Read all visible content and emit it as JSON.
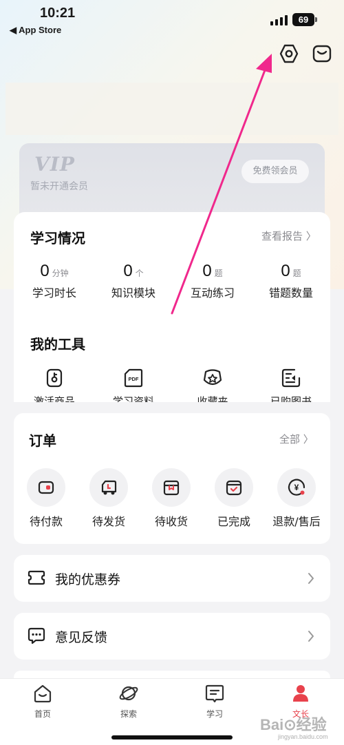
{
  "status_bar": {
    "time": "10:21",
    "back_label": "◀ App Store",
    "battery": "69"
  },
  "header": {
    "settings_icon": "settings-icon",
    "message_icon": "message-icon"
  },
  "vip": {
    "logo": "VIP",
    "status": "暂未开通会员",
    "cta": "免费领会员"
  },
  "study": {
    "title": "学习情况",
    "report_link": "查看报告 〉",
    "stats": [
      {
        "value": "0",
        "unit": "分钟",
        "label": "学习时长"
      },
      {
        "value": "0",
        "unit": "个",
        "label": "知识模块"
      },
      {
        "value": "0",
        "unit": "题",
        "label": "互动练习"
      },
      {
        "value": "0",
        "unit": "题",
        "label": "错题数量"
      }
    ]
  },
  "tools": {
    "title": "我的工具",
    "items": [
      {
        "label": "激活商品",
        "icon": "key-icon"
      },
      {
        "label": "学习资料",
        "icon": "pdf-icon"
      },
      {
        "label": "收藏夹",
        "icon": "star-icon"
      },
      {
        "label": "已购图书",
        "icon": "book-icon"
      }
    ]
  },
  "orders": {
    "title": "订单",
    "all_link": "全部 〉",
    "items": [
      {
        "label": "待付款",
        "icon": "wallet-icon"
      },
      {
        "label": "待发货",
        "icon": "truck-icon"
      },
      {
        "label": "待收货",
        "icon": "box-icon"
      },
      {
        "label": "已完成",
        "icon": "completed-icon"
      },
      {
        "label": "退款/售后",
        "icon": "refund-icon"
      }
    ]
  },
  "coupons": {
    "label": "我的优惠券",
    "icon": "coupon-icon"
  },
  "feedback": {
    "label": "意见反馈",
    "icon": "feedback-icon"
  },
  "tabbar": {
    "items": [
      {
        "label": "首页",
        "icon": "home-icon",
        "active": false
      },
      {
        "label": "探索",
        "icon": "planet-icon",
        "active": false
      },
      {
        "label": "学习",
        "icon": "study-icon",
        "active": false
      },
      {
        "label": "文长",
        "icon": "profile-icon",
        "active": true
      }
    ]
  },
  "colors": {
    "accent": "#e8424c",
    "annotation_arrow": "#f0288c"
  },
  "watermark": {
    "brand": "Bai⊙经验",
    "url": "jingyan.baidu.com"
  }
}
